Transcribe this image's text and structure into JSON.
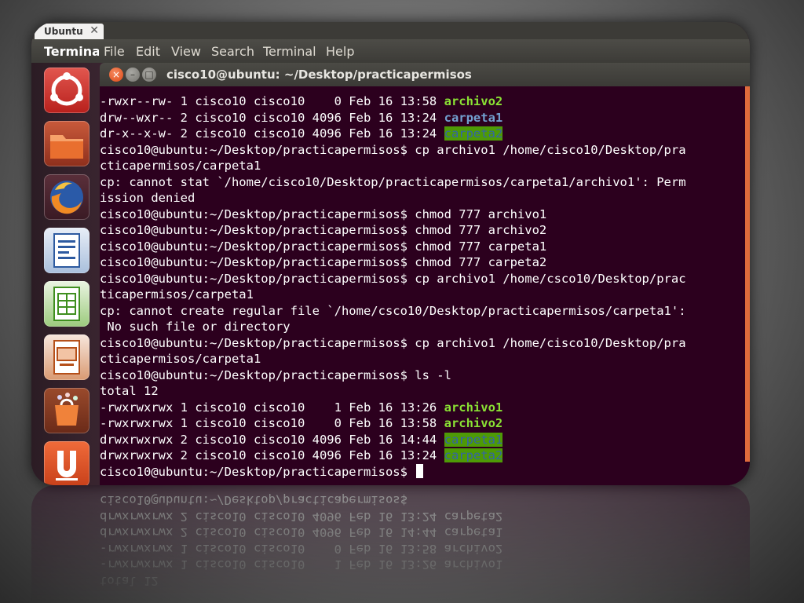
{
  "tab": {
    "label": "Ubuntu",
    "close": "✕"
  },
  "menubar": {
    "app": "Terminal",
    "items": [
      "File",
      "Edit",
      "View",
      "Search",
      "Terminal",
      "Help"
    ]
  },
  "window": {
    "title": "cisco10@ubuntu: ~/Desktop/practicapermisos",
    "close_glyph": "×",
    "min_glyph": "–",
    "max_glyph": "□"
  },
  "launcher": {
    "items": [
      "dash-home",
      "files-folder",
      "firefox",
      "libreoffice-writer",
      "libreoffice-calc",
      "libreoffice-impress",
      "software-center",
      "ubuntu-one"
    ]
  },
  "terminal": {
    "lines": [
      {
        "text": "-rwxr--rw- 1 cisco10 cisco10    0 Feb 16 13:58 ",
        "name": "archivo2",
        "style": "exe"
      },
      {
        "text": "drw--wxr-- 2 cisco10 cisco10 4096 Feb 16 13:24 ",
        "name": "carpeta1",
        "style": "dir"
      },
      {
        "text": "dr-x--x-w- 2 cisco10 cisco10 4096 Feb 16 13:24 ",
        "name": "carpeta2",
        "style": "ow"
      },
      {
        "text": "cisco10@ubuntu:~/Desktop/practicapermisos$ cp archivo1 /home/cisco10/Desktop/pra"
      },
      {
        "text": "cticapermisos/carpeta1"
      },
      {
        "text": "cp: cannot stat `/home/cisco10/Desktop/practicapermisos/carpeta1/archivo1': Perm"
      },
      {
        "text": "ission denied"
      },
      {
        "text": "cisco10@ubuntu:~/Desktop/practicapermisos$ chmod 777 archivo1"
      },
      {
        "text": "cisco10@ubuntu:~/Desktop/practicapermisos$ chmod 777 archivo2"
      },
      {
        "text": "cisco10@ubuntu:~/Desktop/practicapermisos$ chmod 777 carpeta1"
      },
      {
        "text": "cisco10@ubuntu:~/Desktop/practicapermisos$ chmod 777 carpeta2"
      },
      {
        "text": "cisco10@ubuntu:~/Desktop/practicapermisos$ cp archivo1 /home/csco10/Desktop/prac"
      },
      {
        "text": "ticapermisos/carpeta1"
      },
      {
        "text": "cp: cannot create regular file `/home/csco10/Desktop/practicapermisos/carpeta1':"
      },
      {
        "text": " No such file or directory"
      },
      {
        "text": "cisco10@ubuntu:~/Desktop/practicapermisos$ cp archivo1 /home/cisco10/Desktop/pra"
      },
      {
        "text": "cticapermisos/carpeta1"
      },
      {
        "text": "cisco10@ubuntu:~/Desktop/practicapermisos$ ls -l"
      },
      {
        "text": "total 12"
      },
      {
        "text": "-rwxrwxrwx 1 cisco10 cisco10    1 Feb 16 13:26 ",
        "name": "archivo1",
        "style": "exe"
      },
      {
        "text": "-rwxrwxrwx 1 cisco10 cisco10    0 Feb 16 13:58 ",
        "name": "archivo2",
        "style": "exe"
      },
      {
        "text": "drwxrwxrwx 2 cisco10 cisco10 4096 Feb 16 14:44 ",
        "name": "carpeta1",
        "style": "ow"
      },
      {
        "text": "drwxrwxrwx 2 cisco10 cisco10 4096 Feb 16 13:24 ",
        "name": "carpeta2",
        "style": "ow"
      },
      {
        "text": "cisco10@ubuntu:~/Desktop/practicapermisos$ ",
        "cursor": true
      }
    ]
  },
  "colors": {
    "terminal_bg": "#2c001e",
    "executable": "#8ae234",
    "directory": "#729fcf",
    "other_writable_fg": "#3465a4",
    "other_writable_bg": "#4e9a06",
    "accent": "#dd4814"
  }
}
